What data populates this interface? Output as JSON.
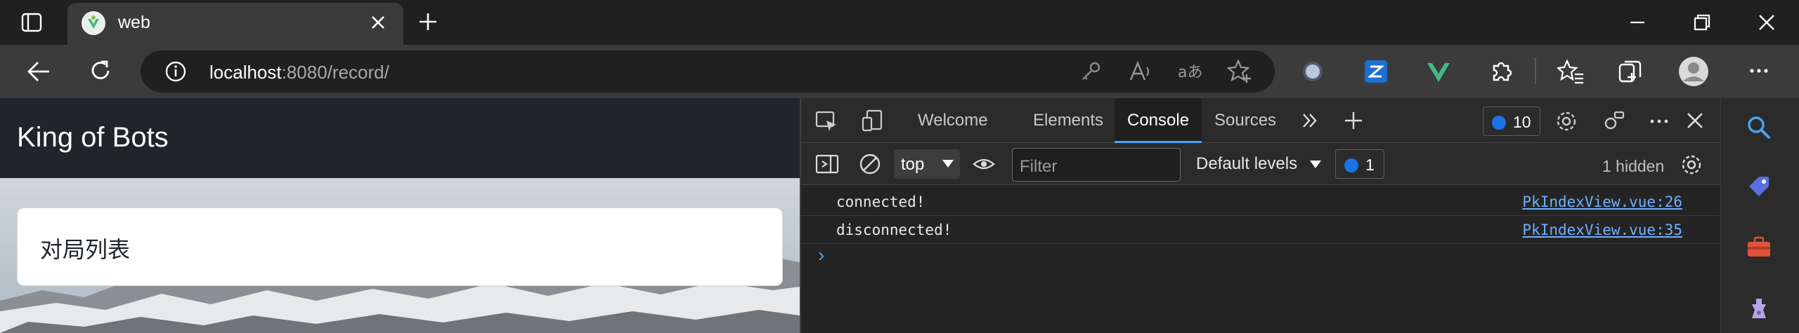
{
  "browser": {
    "tab_title": "web",
    "url_host": "localhost",
    "url_rest": ":8080/record/",
    "colors": {
      "titlebar": "#202020",
      "toolbar": "#3b3b3b",
      "vue": "#42b883",
      "edge_blue": "#1a73e8"
    }
  },
  "page": {
    "brand": "King of Bots",
    "card_title": "对局列表"
  },
  "devtools": {
    "tabs": [
      "Welcome",
      "Elements",
      "Console",
      "Sources"
    ],
    "active_tab": "Console",
    "issues_count": "10",
    "context": "top",
    "filter_placeholder": "Filter",
    "levels": "Default levels",
    "messages_count": "1",
    "hidden": "1 hidden",
    "logs": [
      {
        "message": "connected!",
        "source": "PkIndexView.vue:26"
      },
      {
        "message": "disconnected!",
        "source": "PkIndexView.vue:35"
      }
    ],
    "prompt": "›"
  },
  "icons": [
    "tab-actions-icon",
    "vue-favicon-icon",
    "close-icon",
    "new-tab-icon",
    "minimize-icon",
    "restore-icon",
    "back-icon",
    "refresh-icon",
    "info-icon",
    "key-icon",
    "read-aloud-icon",
    "translate-icon",
    "add-favorite-icon",
    "extension-icon",
    "vue-devtools-icon",
    "extensions-icon",
    "favorites-icon",
    "collections-icon",
    "profile-icon",
    "more-icon",
    "search-icon",
    "tag-icon",
    "toolbox-icon",
    "games-icon"
  ]
}
